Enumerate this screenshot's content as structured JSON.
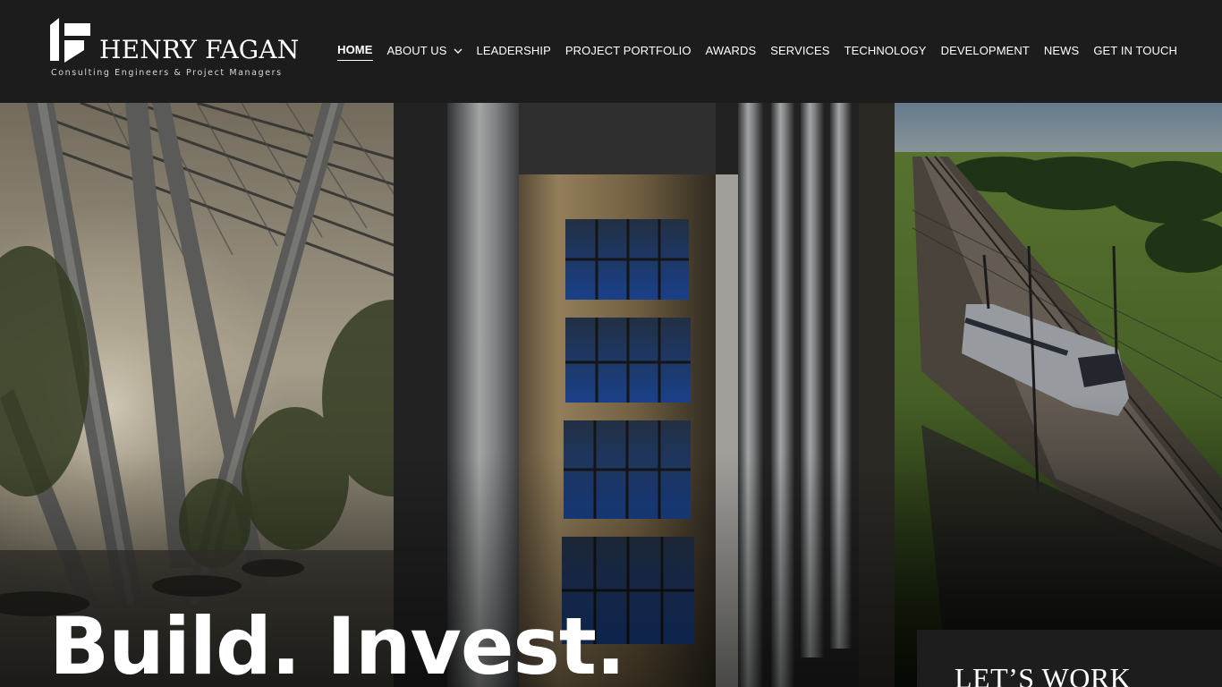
{
  "brand": {
    "name": "HENRY FAGAN",
    "tagline": "Consulting Engineers & Project Managers",
    "logo_icon": "hf-monogram-icon"
  },
  "nav": {
    "items": [
      {
        "label": "HOME",
        "active": true
      },
      {
        "label": "ABOUT US",
        "has_dropdown": true
      },
      {
        "label": "LEADERSHIP"
      },
      {
        "label": "PROJECT PORTFOLIO"
      },
      {
        "label": "AWARDS"
      },
      {
        "label": "SERVICES"
      },
      {
        "label": "TECHNOLOGY"
      },
      {
        "label": "DEVELOPMENT"
      },
      {
        "label": "NEWS"
      },
      {
        "label": "GET IN TOUCH"
      }
    ],
    "dropdown_icon": "chevron-down-icon"
  },
  "hero": {
    "headline": "Build. Invest.",
    "cta_title": "LET’S WORK"
  },
  "colors": {
    "header_bg": "#1c1c1c",
    "panel_bg": "#1d1d1d",
    "text": "#ffffff"
  }
}
